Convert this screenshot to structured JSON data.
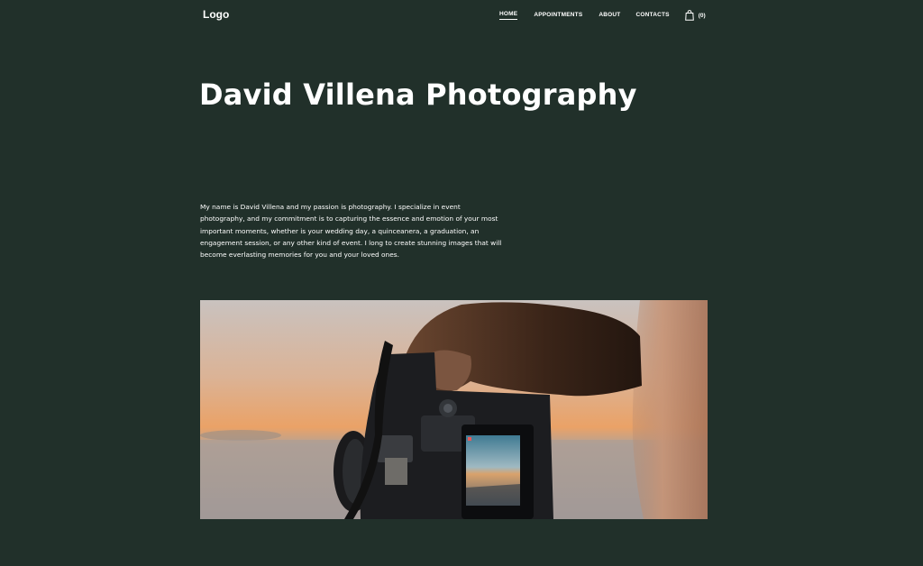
{
  "header": {
    "logo": "Logo",
    "nav": {
      "home": "HOME",
      "appointments": "APPOINTMENTS",
      "about": "ABOUT",
      "contacts": "CONTACTS"
    },
    "cart_count": "(0)",
    "cart_icon": "shopping-bag-icon"
  },
  "hero": {
    "title": "David Villena Photography"
  },
  "intro": {
    "text": "My name is David Villena and my passion is photography. I specialize in event photography, and my commitment is to capturing the essence and emotion of your most important moments, whether is your wedding day, a quinceanera, a graduation, an engagement session, or any other kind of event. I long to create stunning images that will become everlasting memories for you and your loved ones."
  },
  "colors": {
    "background": "#21302a",
    "text": "#ffffff"
  }
}
